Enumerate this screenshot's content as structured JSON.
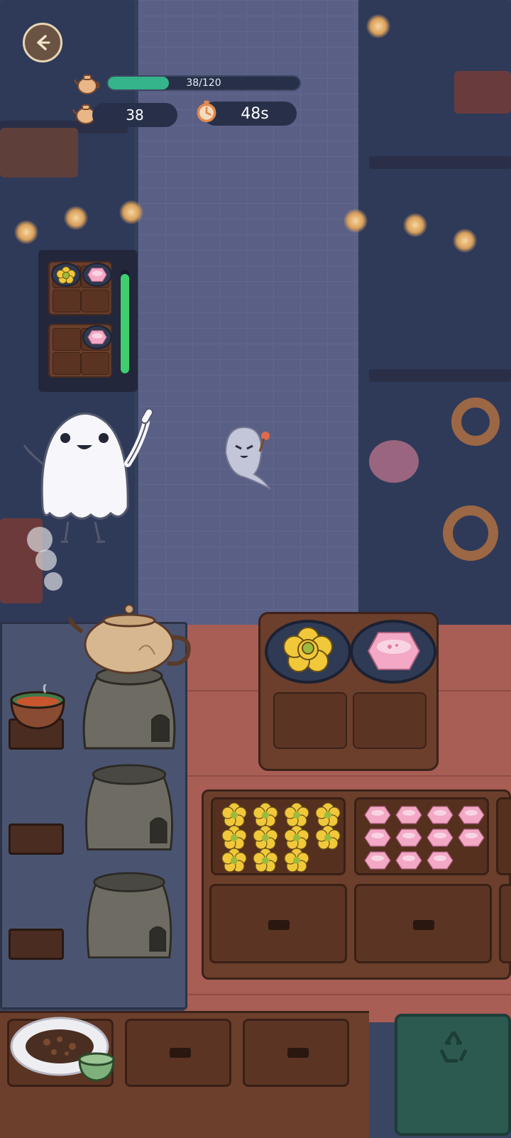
{
  "hud": {
    "progress": {
      "current": 38,
      "target": 120,
      "text": "38/120",
      "fraction": 0.317
    },
    "coins": "38",
    "timer": "48s",
    "back_icon": "back-arrow-icon",
    "teapot_icon": "teapot-icon",
    "timer_icon": "stopwatch-icon"
  },
  "order": {
    "trays": [
      {
        "items": [
          "yellow-flower-pastry",
          "pink-hexagon-pastry"
        ]
      },
      {
        "items": [
          "pink-hexagon-pastry"
        ]
      }
    ],
    "patience_fraction": 0.96
  },
  "serving_tray": {
    "items": [
      "yellow-flower-pastry",
      "pink-hexagon-pastry"
    ]
  },
  "inventory": {
    "yellow_flower_pastry_count": 11,
    "pink_hexagon_pastry_count": 11
  },
  "colors": {
    "progress_fill": "#35b38a",
    "patience_fill": "#3fcf6e",
    "yellow_pastry": "#f1c83a",
    "pink_pastry": "#f3a8c6",
    "counter": "#a85d55"
  }
}
